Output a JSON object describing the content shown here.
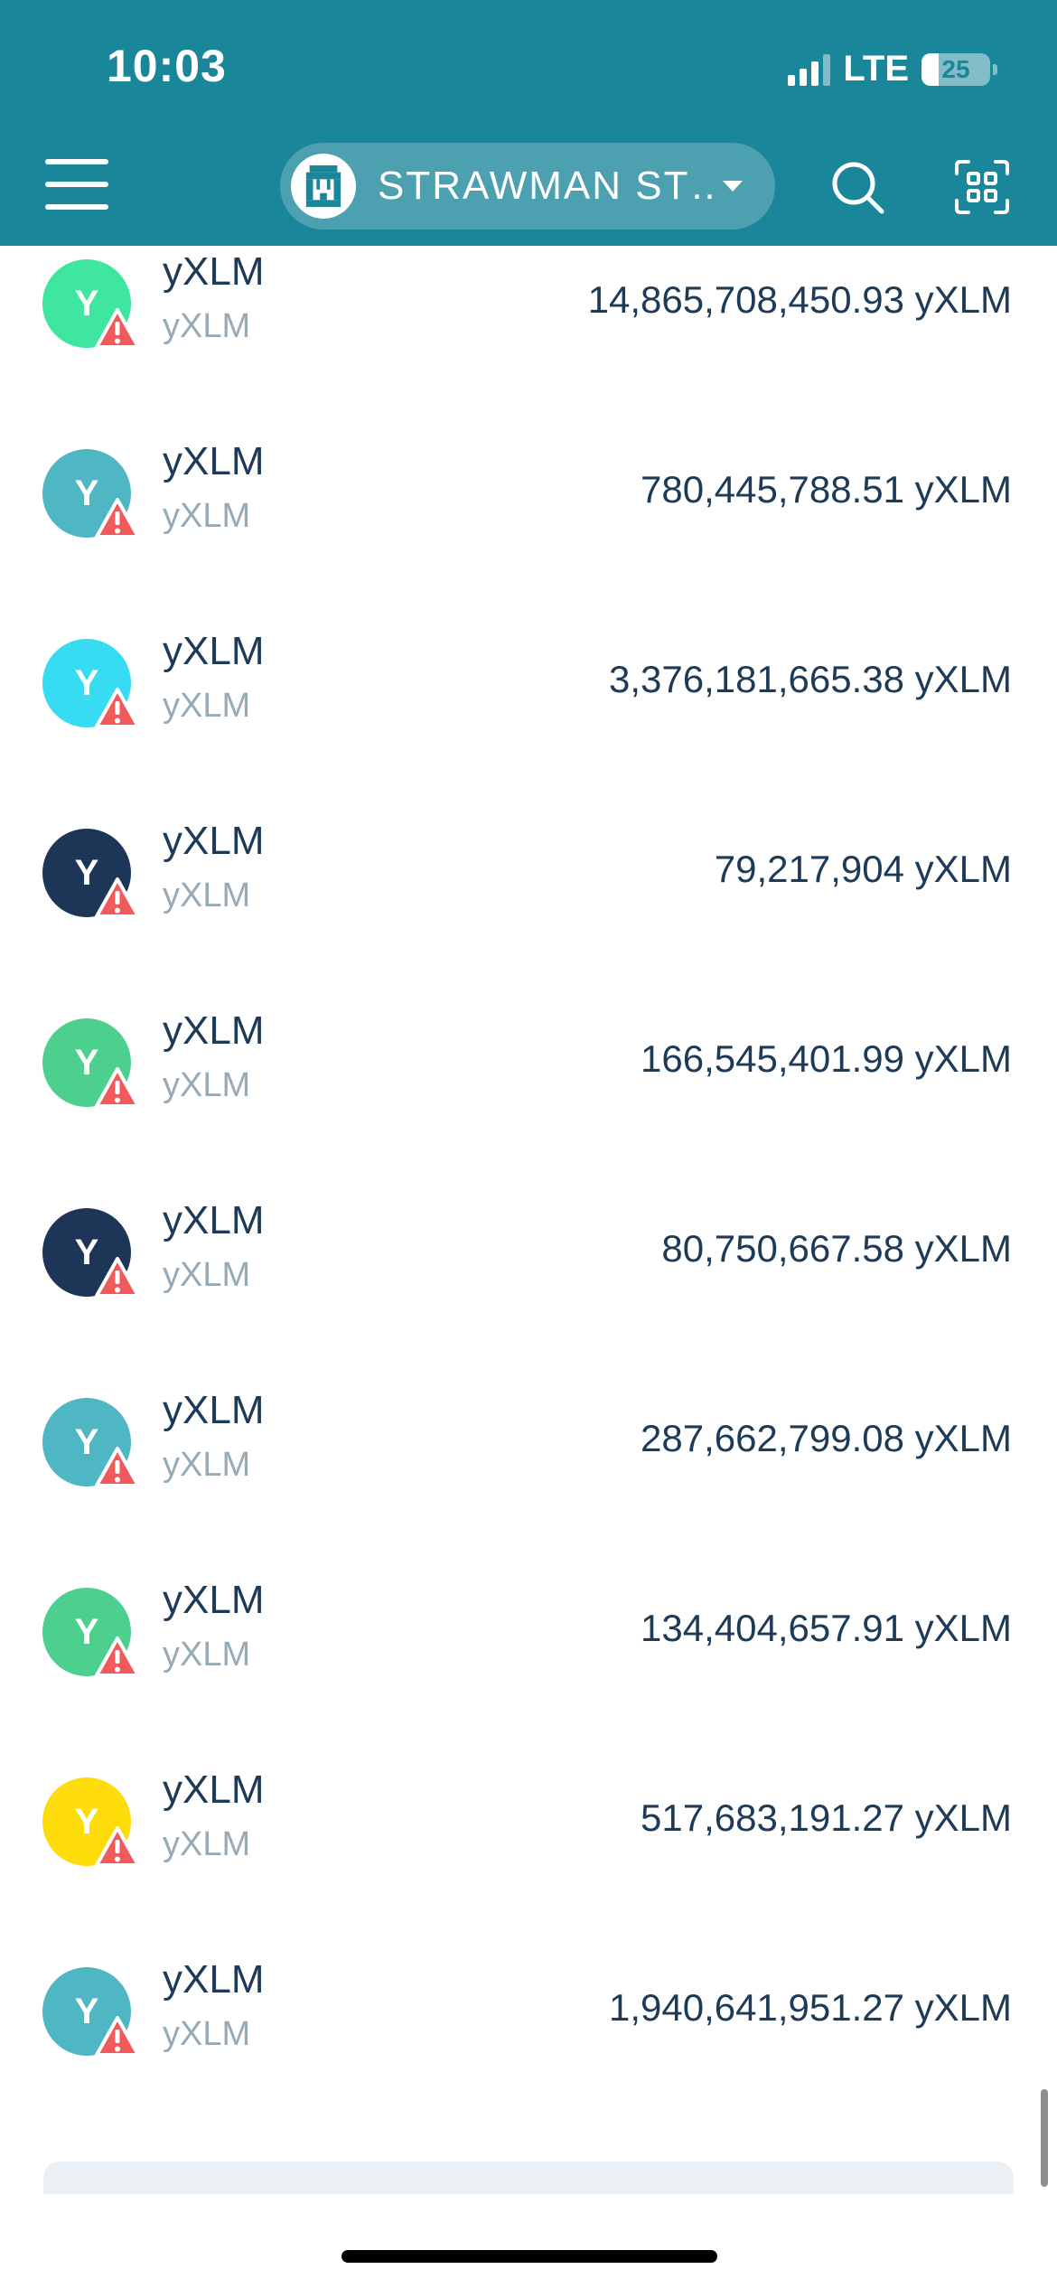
{
  "status_bar": {
    "time": "10:03",
    "network": "LTE",
    "battery": "25",
    "battery_level": 0.25
  },
  "header": {
    "account_name": "STRAWMAN ST…",
    "icons": [
      "menu-icon",
      "account-avatar-icon",
      "chevron-down-icon",
      "search-icon",
      "qr-scan-icon"
    ]
  },
  "colors": {
    "header_bg": "#1a869a",
    "text_primary": "#1d3a57",
    "text_secondary": "#97aab8",
    "warning": "#f15a5a"
  },
  "assets": [
    {
      "avatar_letter": "Y",
      "avatar_color": "#3ee69f",
      "name": "yXLM",
      "code": "yXLM",
      "balance": "14,865,708,450.93 yXLM"
    },
    {
      "avatar_letter": "Y",
      "avatar_color": "#4fb7c4",
      "name": "yXLM",
      "code": "yXLM",
      "balance": "780,445,788.51 yXLM"
    },
    {
      "avatar_letter": "Y",
      "avatar_color": "#38dcf2",
      "name": "yXLM",
      "code": "yXLM",
      "balance": "3,376,181,665.38 yXLM"
    },
    {
      "avatar_letter": "Y",
      "avatar_color": "#1d3557",
      "name": "yXLM",
      "code": "yXLM",
      "balance": "79,217,904 yXLM"
    },
    {
      "avatar_letter": "Y",
      "avatar_color": "#4dd08e",
      "name": "yXLM",
      "code": "yXLM",
      "balance": "166,545,401.99 yXLM"
    },
    {
      "avatar_letter": "Y",
      "avatar_color": "#1d3557",
      "name": "yXLM",
      "code": "yXLM",
      "balance": "80,750,667.58 yXLM"
    },
    {
      "avatar_letter": "Y",
      "avatar_color": "#4fb7c4",
      "name": "yXLM",
      "code": "yXLM",
      "balance": "287,662,799.08 yXLM"
    },
    {
      "avatar_letter": "Y",
      "avatar_color": "#4dd08e",
      "name": "yXLM",
      "code": "yXLM",
      "balance": "134,404,657.91 yXLM"
    },
    {
      "avatar_letter": "Y",
      "avatar_color": "#fedb0b",
      "name": "yXLM",
      "code": "yXLM",
      "balance": "517,683,191.27 yXLM"
    },
    {
      "avatar_letter": "Y",
      "avatar_color": "#4fb7c4",
      "name": "yXLM",
      "code": "yXLM",
      "balance": "1,940,641,951.27 yXLM"
    }
  ]
}
